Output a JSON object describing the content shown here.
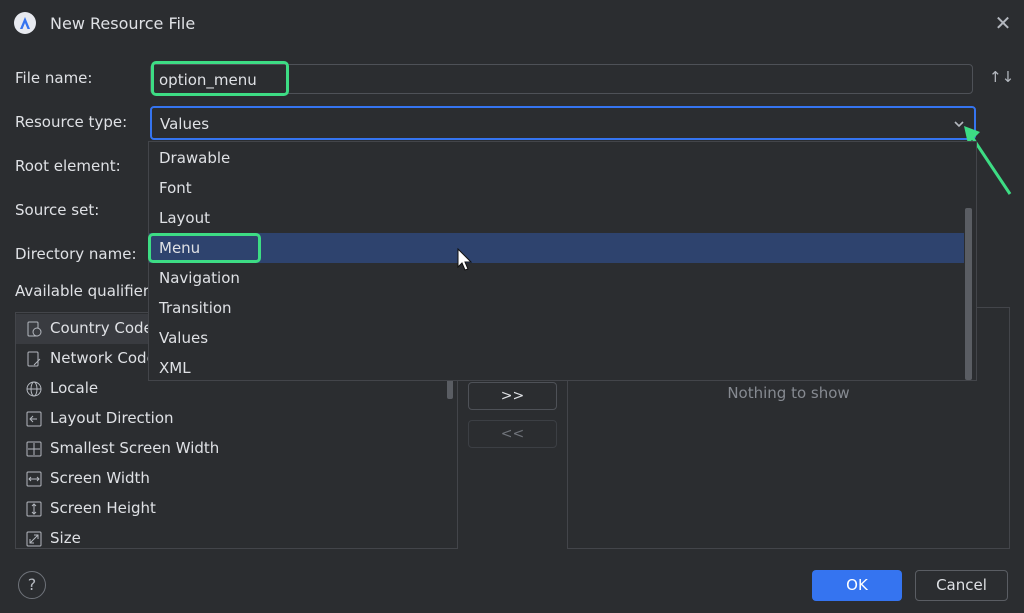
{
  "window": {
    "title": "New Resource File"
  },
  "form": {
    "file_name_label": "File name:",
    "file_name_value": "option_menu",
    "resource_type_label": "Resource type:",
    "resource_type_value": "Values",
    "root_element_label": "Root element:",
    "source_set_label": "Source set:",
    "directory_name_label": "Directory name:",
    "available_qualifiers_label": "Available qualifier"
  },
  "dropdown": {
    "options": [
      "Drawable",
      "Font",
      "Layout",
      "Menu",
      "Navigation",
      "Transition",
      "Values",
      "XML"
    ],
    "highlighted": "Menu"
  },
  "qualifiers": [
    {
      "label": "Country Code",
      "icon": "country-code-icon"
    },
    {
      "label": "Network Code",
      "icon": "network-code-icon"
    },
    {
      "label": "Locale",
      "icon": "globe-icon"
    },
    {
      "label": "Layout Direction",
      "icon": "layout-direction-icon"
    },
    {
      "label": "Smallest Screen Width",
      "icon": "smallest-width-icon"
    },
    {
      "label": "Screen Width",
      "icon": "screen-width-icon"
    },
    {
      "label": "Screen Height",
      "icon": "screen-height-icon"
    },
    {
      "label": "Size",
      "icon": "size-icon"
    }
  ],
  "transfer": {
    "add_label": ">>",
    "remove_label": "<<"
  },
  "chosen": {
    "empty_text": "Nothing to show"
  },
  "footer": {
    "ok_label": "OK",
    "cancel_label": "Cancel",
    "help_label": "?"
  },
  "colors": {
    "accent": "#3574f0",
    "highlight": "#3ddc84",
    "selection": "#2e436e"
  }
}
